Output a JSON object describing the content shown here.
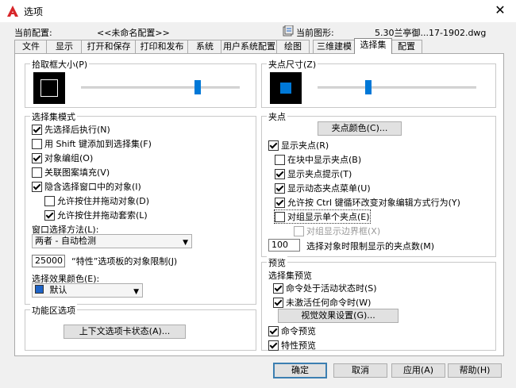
{
  "window": {
    "title": "选项",
    "close_glyph": "✕"
  },
  "header": {
    "current_profile_label": "当前配置:",
    "current_profile_value": "<<未命名配置>>",
    "current_drawing_label": "当前图形:",
    "current_drawing_value": "5.30兰亭御...17-1902.dwg"
  },
  "tabs": [
    "文件",
    "显示",
    "打开和保存",
    "打印和发布",
    "系统",
    "用户系统配置",
    "绘图",
    "三维建模",
    "选择集",
    "配置"
  ],
  "active_tab": "选择集",
  "pickbox": {
    "title": "拾取框大小(P)",
    "slider_level": 0.72
  },
  "grip_size": {
    "title": "夹点尺寸(Z)",
    "slider_level": 0.45,
    "color": "#0078d7"
  },
  "selection_modes": {
    "title": "选择集模式",
    "items": [
      {
        "label": "先选择后执行(N)",
        "checked": true
      },
      {
        "label": "用 Shift 键添加到选择集(F)",
        "checked": false
      },
      {
        "label": "对象编组(O)",
        "checked": true
      },
      {
        "label": "关联图案填充(V)",
        "checked": false
      },
      {
        "label": "隐含选择窗口中的对象(I)",
        "checked": true
      },
      {
        "label": "允许按住并拖动对象(D)",
        "checked": false
      },
      {
        "label": "允许按住并拖动套索(L)",
        "checked": true
      }
    ],
    "window_method_label": "窗口选择方法(L):",
    "window_method_value": "两者 - 自动检测",
    "property_limit_value": "25000",
    "property_limit_label": "“特性”选项板的对象限制(J)",
    "effect_color_label": "选择效果颜色(E):",
    "effect_color_value": "默认",
    "effect_color_swatch": "#1e64c8"
  },
  "ribbon": {
    "title": "功能区选项",
    "button": "上下文选项卡状态(A)..."
  },
  "grips": {
    "title": "夹点",
    "color_button": "夹点颜色(C)...",
    "items": [
      {
        "label": "显示夹点(R)",
        "checked": true
      },
      {
        "label": "在块中显示夹点(B)",
        "checked": false
      },
      {
        "label": "显示夹点提示(T)",
        "checked": true
      },
      {
        "label": "显示动态夹点菜单(U)",
        "checked": true
      },
      {
        "label": "允许按 Ctrl 键循环改变对象编辑方式行为(Y)",
        "checked": true
      },
      {
        "label": "对组显示单个夹点(E)",
        "checked": false
      },
      {
        "label": "对组显示边界框(X)",
        "checked": false,
        "disabled": true
      }
    ],
    "limit_value": "100",
    "limit_label": "选择对象时限制显示的夹点数(M)"
  },
  "preview": {
    "title": "预览",
    "sub_title": "选择集预览",
    "items": [
      {
        "label": "命令处于活动状态时(S)",
        "checked": true
      },
      {
        "label": "未激活任何命令时(W)",
        "checked": true
      }
    ],
    "visual_button": "视觉效果设置(G)...",
    "cmd_preview": {
      "label": "命令预览",
      "checked": true
    },
    "prop_preview": {
      "label": "特性预览",
      "checked": true
    }
  },
  "footer": {
    "ok": "确定",
    "cancel": "取消",
    "apply": "应用(A)",
    "help": "帮助(H)"
  }
}
